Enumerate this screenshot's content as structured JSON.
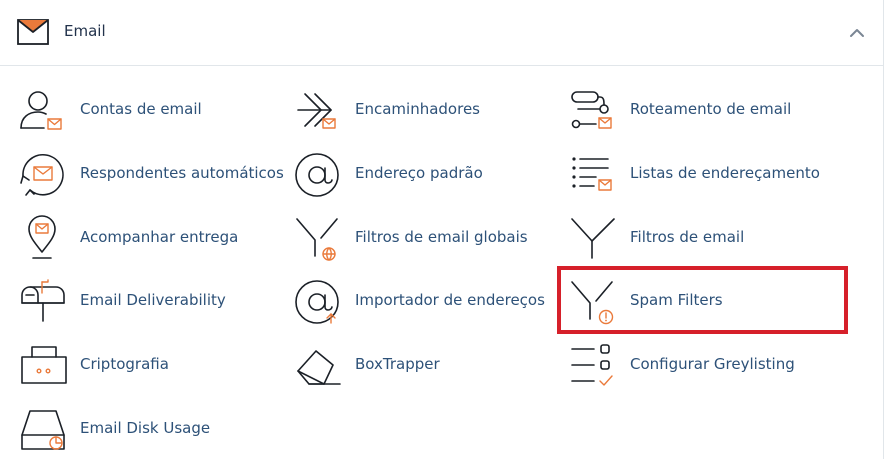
{
  "section": {
    "title": "Email",
    "icon": "envelope-icon",
    "collapse_icon": "chevron-up-icon"
  },
  "accent_color": "#ea7a3b",
  "highlight_color": "#d6202a",
  "items": [
    {
      "label": "Contas de email",
      "icon": "user-mail-icon"
    },
    {
      "label": "Encaminhadores",
      "icon": "forward-arrow-icon"
    },
    {
      "label": "Roteamento de email",
      "icon": "routing-icon"
    },
    {
      "label": "Respondentes automáticos",
      "icon": "autoresponder-icon"
    },
    {
      "label": "Endereço padrão",
      "icon": "at-sign-icon"
    },
    {
      "label": "Listas de endereçamento",
      "icon": "mailing-list-icon"
    },
    {
      "label": "Acompanhar entrega",
      "icon": "location-pin-icon"
    },
    {
      "label": "Filtros de email globais",
      "icon": "global-filter-icon"
    },
    {
      "label": "Filtros de email",
      "icon": "filter-icon"
    },
    {
      "label": "Email Deliverability",
      "icon": "mailbox-icon"
    },
    {
      "label": "Importador de endereços",
      "icon": "at-import-icon"
    },
    {
      "label": "Spam Filters",
      "icon": "spam-filter-icon"
    },
    {
      "label": "Criptografia",
      "icon": "encryption-icon"
    },
    {
      "label": "BoxTrapper",
      "icon": "boxtrapper-icon"
    },
    {
      "label": "Configurar Greylisting",
      "icon": "greylisting-icon"
    },
    {
      "label": "Email Disk Usage",
      "icon": "disk-usage-icon"
    }
  ]
}
